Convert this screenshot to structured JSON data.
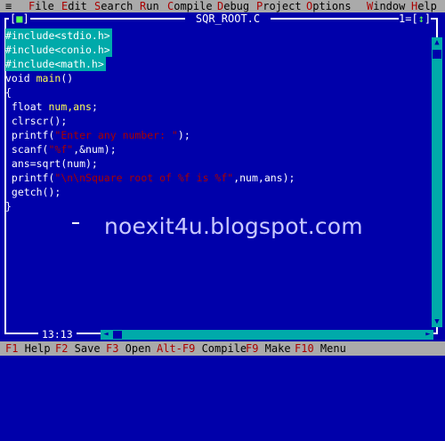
{
  "menu": {
    "system_icon": "≡",
    "items": [
      {
        "hot": "F",
        "rest": "ile"
      },
      {
        "hot": "E",
        "rest": "dit"
      },
      {
        "hot": "S",
        "rest": "earch"
      },
      {
        "hot": "R",
        "rest": "un"
      },
      {
        "hot": "C",
        "rest": "ompile"
      },
      {
        "hot": "D",
        "rest": "ebug"
      },
      {
        "hot": "P",
        "rest": "roject"
      },
      {
        "hot": "O",
        "rest": "ptions"
      },
      {
        "hot": "W",
        "rest": "indow"
      },
      {
        "hot": "H",
        "rest": "elp"
      }
    ]
  },
  "window": {
    "close_mark": "■",
    "title": "SQR_ROOT.C",
    "number": "1",
    "zoom_mark": "↕"
  },
  "code": {
    "l1": {
      "pp": "#include<stdio.h>"
    },
    "l2": {
      "pp": "#include<conio.h>"
    },
    "l3": {
      "pp": "#include<math.h>"
    },
    "l4": {
      "kw": "void",
      "id": " main",
      "t": "()"
    },
    "l5": {
      "t": "{"
    },
    "l6": {
      "kw": " float",
      "id": " num,ans",
      "t": ";"
    },
    "l7": {
      "id": " clrscr",
      "t": "();"
    },
    "l8": {
      "id": " printf",
      "t1": "(",
      "str": "\"Enter any number: \"",
      "t2": ");"
    },
    "l9": {
      "id": " scanf",
      "t1": "(",
      "str": "\"%f\"",
      "t2": ",&num);"
    },
    "l10": {
      "id": " ans=sqrt",
      "t": "(num);"
    },
    "l11": {
      "id": " printf",
      "t1": "(",
      "str": "\"\\n\\nSquare root of %f is %f\"",
      "t2": ",num,ans);"
    },
    "l12": {
      "id": " getch",
      "t": "();"
    },
    "l13": {
      "t": "}"
    }
  },
  "watermark": "noexit4u.blogspot.com",
  "status": {
    "position": "13:13"
  },
  "fkeys": [
    {
      "key": "F1",
      "label": " Help"
    },
    {
      "key": "F2",
      "label": " Save"
    },
    {
      "key": "F3",
      "label": " Open"
    },
    {
      "key": "Alt-F9",
      "label": " Compile"
    },
    {
      "key": "F9",
      "label": " Make"
    },
    {
      "key": "F10",
      "label": " Menu"
    }
  ],
  "colors": {
    "background": "#0000aa",
    "menu_bg": "#aaaaaa",
    "hotkey": "#aa0000",
    "preprocessor_bg": "#00aaaa",
    "identifier": "#ffff55",
    "string": "#aa0000"
  }
}
